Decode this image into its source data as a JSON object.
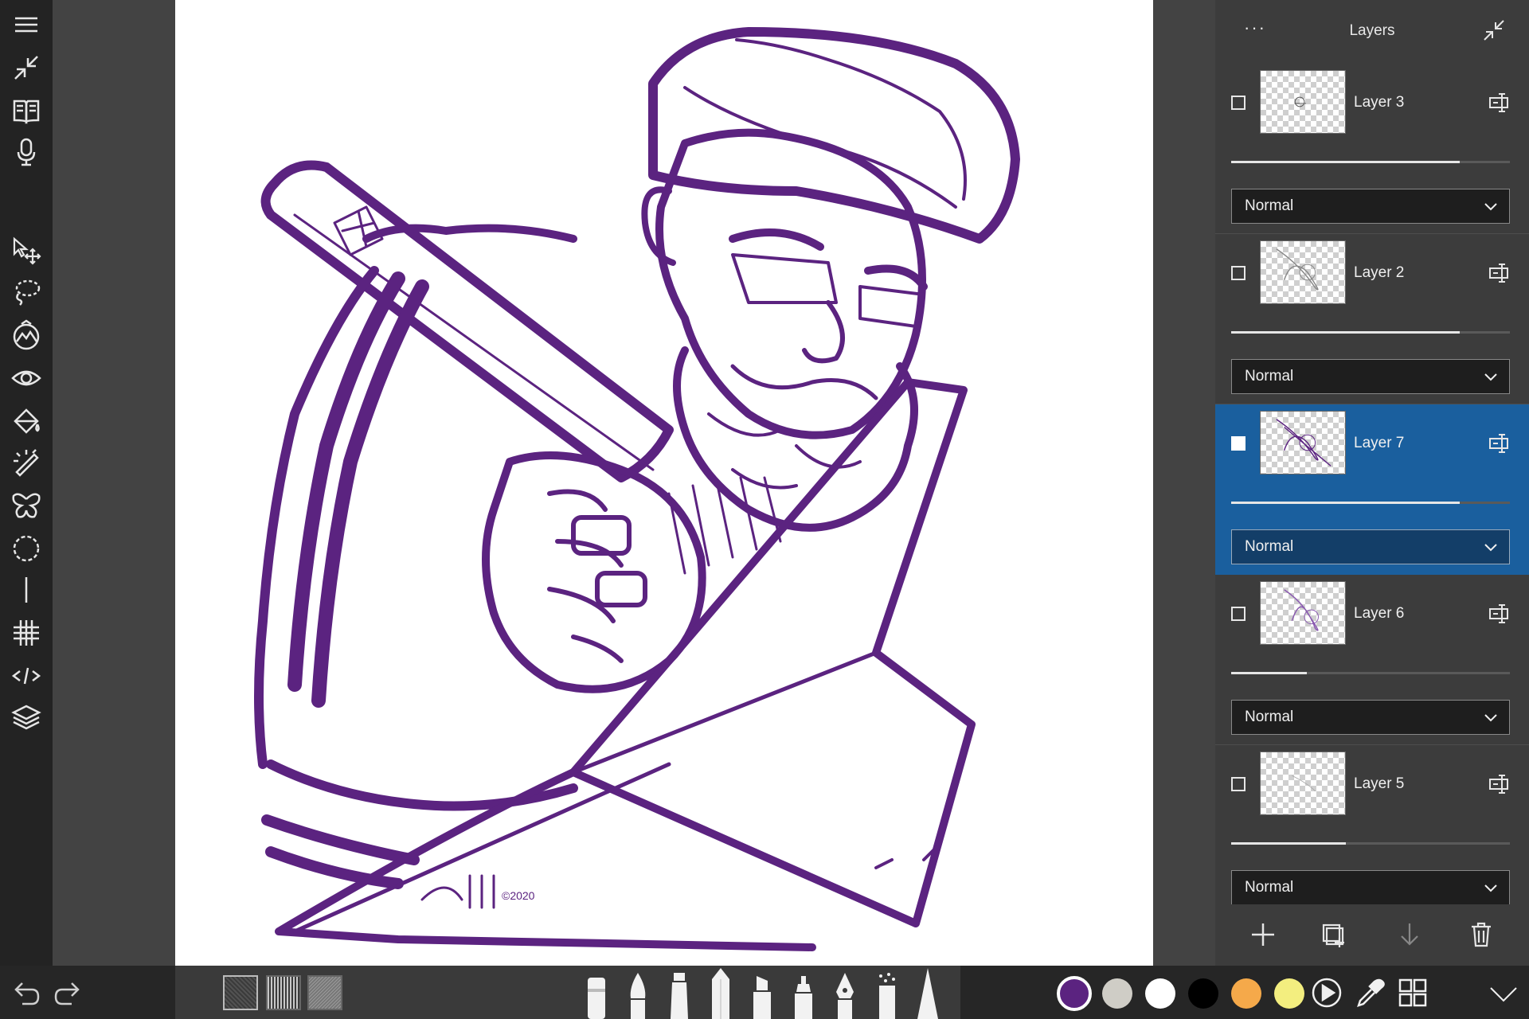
{
  "layers_panel": {
    "title": "Layers",
    "more_label": "···",
    "layers": [
      {
        "name": "Layer 3",
        "blend_mode": "Normal",
        "opacity": 0.82,
        "selected": false,
        "visible_checked": false
      },
      {
        "name": "Layer 2",
        "blend_mode": "Normal",
        "opacity": 0.82,
        "selected": false,
        "visible_checked": false
      },
      {
        "name": "Layer 7",
        "blend_mode": "Normal",
        "opacity": 0.82,
        "selected": true,
        "visible_checked": true
      },
      {
        "name": "Layer 6",
        "blend_mode": "Normal",
        "opacity": 0.27,
        "selected": false,
        "visible_checked": false
      },
      {
        "name": "Layer 5",
        "blend_mode": "Normal",
        "opacity": 0.41,
        "selected": false,
        "visible_checked": false
      }
    ],
    "footer_icons": [
      "add-layer-icon",
      "duplicate-layer-icon",
      "merge-down-icon",
      "delete-layer-icon"
    ]
  },
  "left_toolbar": {
    "icons": [
      "menu-icon",
      "collapse-icon",
      "gallery-icon",
      "microphone-icon",
      "transform-icon",
      "lasso-select-icon",
      "adjustments-icon",
      "visibility-icon",
      "fill-icon",
      "magic-wand-icon",
      "symmetry-icon",
      "selection-icon",
      "ruler-icon",
      "grid-icon",
      "perspective-icon",
      "layers-icon"
    ]
  },
  "bottom_bar": {
    "icons": [
      "undo-icon",
      "redo-icon",
      "play-icon",
      "eyedropper-icon",
      "color-grid-icon",
      "expand-icon"
    ],
    "colors": [
      "#5b2380",
      "#cfcdc6",
      "#ffffff",
      "#000000",
      "#f5a94a",
      "#f3ee7f"
    ],
    "active_color": "#5b2380",
    "brushes": [
      "marker-brush",
      "round-brush",
      "ink-brush",
      "pencil-brush",
      "chisel-marker-brush",
      "felt-marker-brush",
      "fountain-pen-brush",
      "spray-brush",
      "cone-brush"
    ]
  },
  "theme": {
    "accent": "#1a5f9e",
    "ink_color": "#5b2380"
  }
}
